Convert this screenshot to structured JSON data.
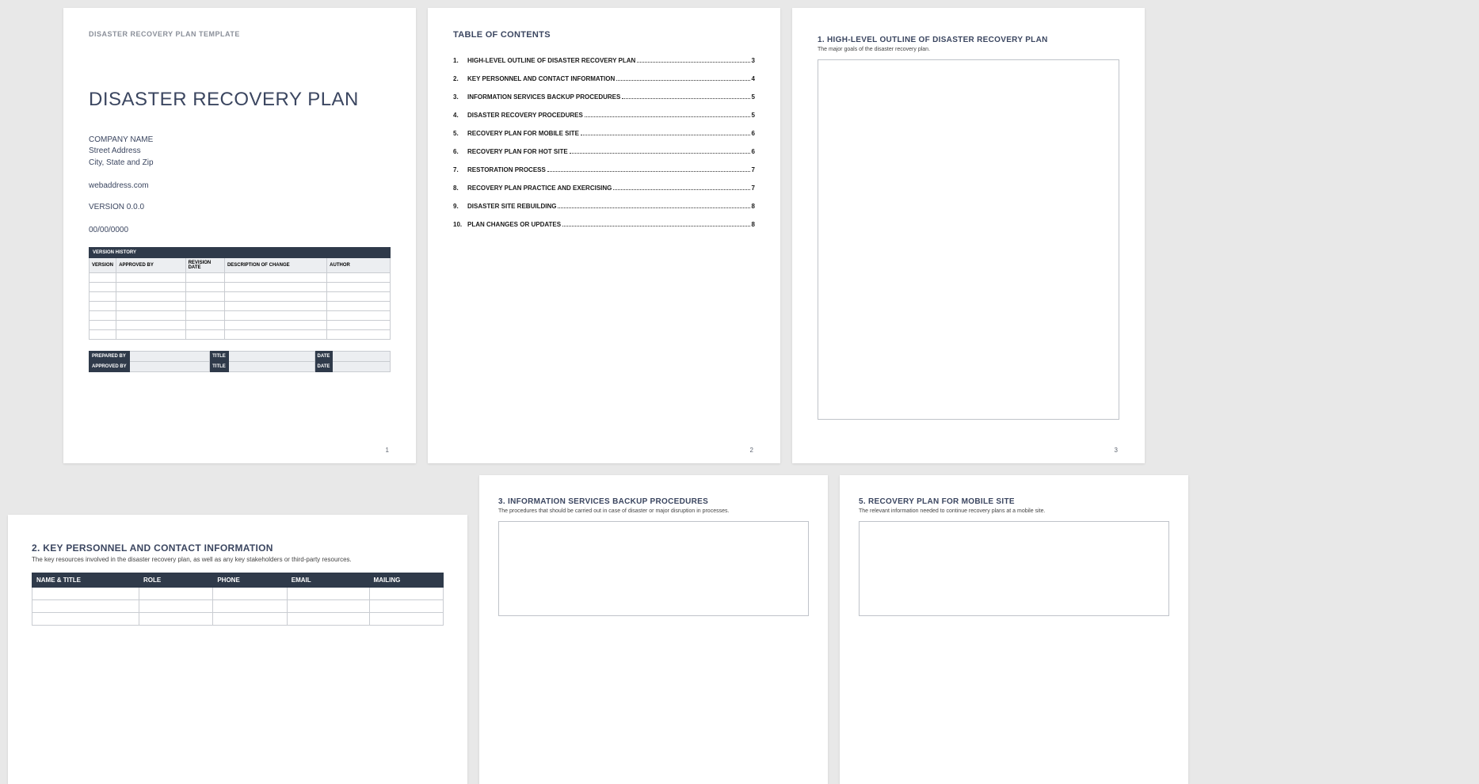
{
  "page1": {
    "template_label": "DISASTER RECOVERY PLAN TEMPLATE",
    "title": "DISASTER RECOVERY PLAN",
    "company_name": "COMPANY NAME",
    "street": "Street Address",
    "city_state_zip": "City, State and Zip",
    "web": "webaddress.com",
    "version": "VERSION 0.0.0",
    "date": "00/00/0000",
    "vh_header": "VERSION HISTORY",
    "vh_cols": [
      "VERSION",
      "APPROVED BY",
      "REVISION DATE",
      "DESCRIPTION OF CHANGE",
      "AUTHOR"
    ],
    "sig": {
      "prepared": "PREPARED BY",
      "approved": "APPROVED BY",
      "title": "TITLE",
      "date": "DATE"
    },
    "page_num": "1"
  },
  "page2": {
    "title": "TABLE OF CONTENTS",
    "items": [
      {
        "n": "1.",
        "t": "HIGH-LEVEL OUTLINE OF DISASTER RECOVERY PLAN",
        "p": "3"
      },
      {
        "n": "2.",
        "t": "KEY PERSONNEL AND CONTACT INFORMATION",
        "p": "4"
      },
      {
        "n": "3.",
        "t": "INFORMATION SERVICES BACKUP PROCEDURES",
        "p": "5"
      },
      {
        "n": "4.",
        "t": "DISASTER RECOVERY PROCEDURES",
        "p": "5"
      },
      {
        "n": "5.",
        "t": "RECOVERY PLAN FOR MOBILE SITE",
        "p": "6"
      },
      {
        "n": "6.",
        "t": "RECOVERY PLAN FOR HOT SITE",
        "p": "6"
      },
      {
        "n": "7.",
        "t": "RESTORATION PROCESS",
        "p": "7"
      },
      {
        "n": "8.",
        "t": "RECOVERY PLAN PRACTICE AND EXERCISING",
        "p": "7"
      },
      {
        "n": "9.",
        "t": "DISASTER SITE REBUILDING",
        "p": "8"
      },
      {
        "n": "10.",
        "t": "PLAN CHANGES OR UPDATES",
        "p": "8"
      }
    ],
    "page_num": "2"
  },
  "page3": {
    "heading": "1.  HIGH-LEVEL OUTLINE OF DISASTER RECOVERY PLAN",
    "sub": "The major goals of the disaster recovery plan.",
    "page_num": "3"
  },
  "page4": {
    "heading": "2.  KEY PERSONNEL AND CONTACT INFORMATION",
    "sub": "The key resources involved in the disaster recovery plan, as well as any key stakeholders or third-party resources.",
    "cols": [
      "NAME & TITLE",
      "ROLE",
      "PHONE",
      "EMAIL",
      "MAILING"
    ]
  },
  "page5": {
    "heading": "3.  INFORMATION SERVICES BACKUP PROCEDURES",
    "sub": "The procedures that should be carried out in case of disaster or major disruption in processes."
  },
  "page6": {
    "heading": "5.  RECOVERY PLAN FOR MOBILE SITE",
    "sub": "The relevant information needed to continue recovery plans at a mobile site."
  }
}
